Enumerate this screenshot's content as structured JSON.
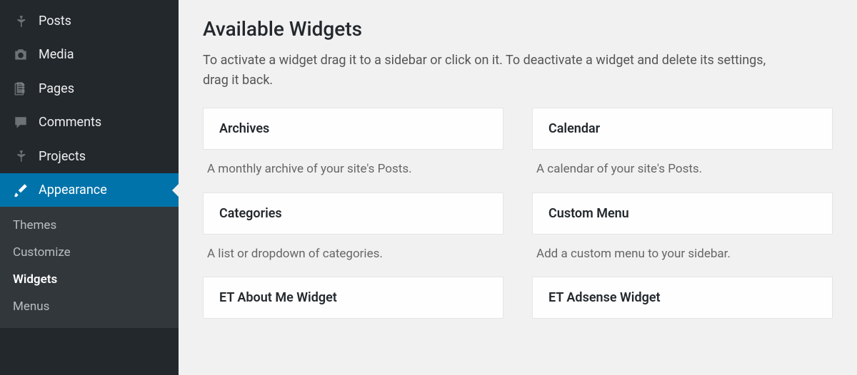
{
  "sidebar": {
    "items": [
      {
        "label": "Posts",
        "icon": "pushpin"
      },
      {
        "label": "Media",
        "icon": "camera"
      },
      {
        "label": "Pages",
        "icon": "pages"
      },
      {
        "label": "Comments",
        "icon": "comment"
      },
      {
        "label": "Projects",
        "icon": "pushpin"
      },
      {
        "label": "Appearance",
        "icon": "brush",
        "active": true
      }
    ],
    "submenu": [
      {
        "label": "Themes"
      },
      {
        "label": "Customize"
      },
      {
        "label": "Widgets",
        "current": true
      },
      {
        "label": "Menus"
      }
    ]
  },
  "content": {
    "title": "Available Widgets",
    "description": "To activate a widget drag it to a sidebar or click on it. To deactivate a widget and delete its settings, drag it back.",
    "widgets": [
      {
        "name": "Archives",
        "desc": "A monthly archive of your site's Posts."
      },
      {
        "name": "Calendar",
        "desc": "A calendar of your site's Posts."
      },
      {
        "name": "Categories",
        "desc": "A list or dropdown of categories."
      },
      {
        "name": "Custom Menu",
        "desc": "Add a custom menu to your sidebar."
      },
      {
        "name": "ET About Me Widget",
        "desc": ""
      },
      {
        "name": "ET Adsense Widget",
        "desc": ""
      }
    ]
  }
}
